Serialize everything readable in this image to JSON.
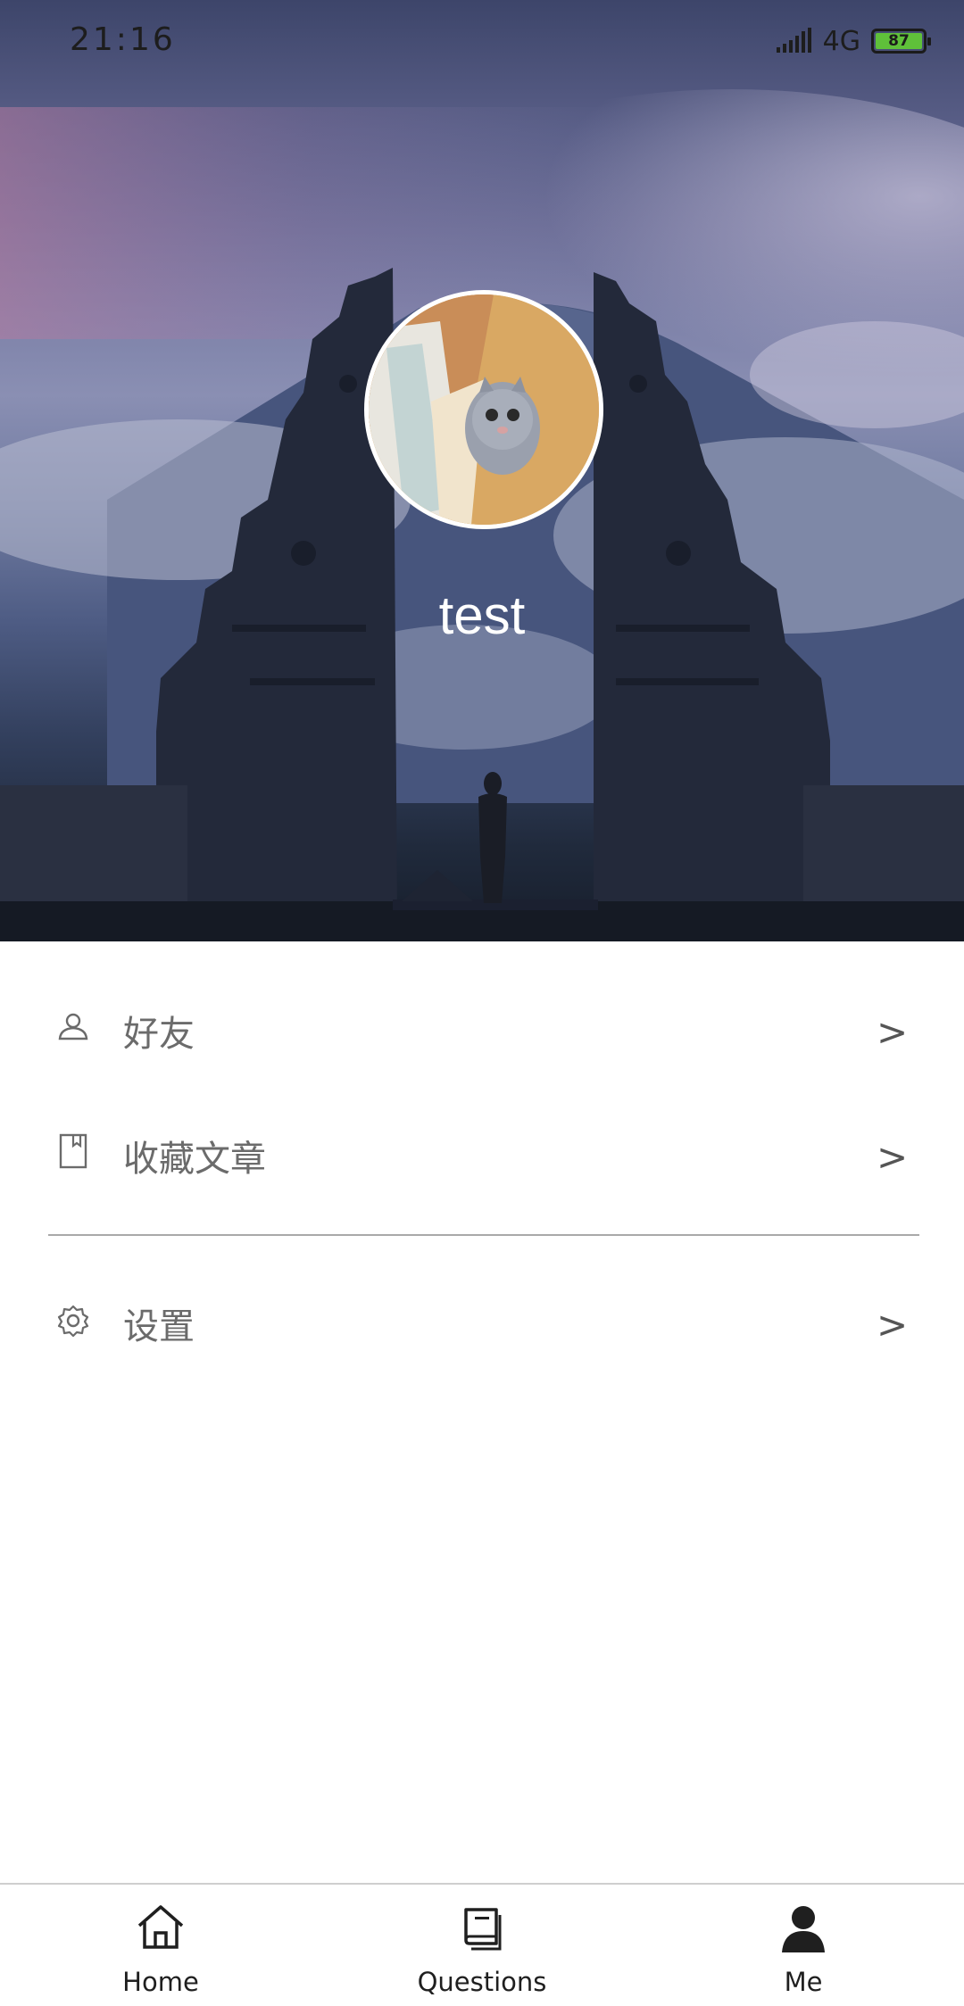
{
  "status_bar": {
    "time": "21:16",
    "network": "4G",
    "battery_level": "87"
  },
  "profile": {
    "username": "test",
    "avatar_icon": "cat-photo-avatar"
  },
  "menu": {
    "items": [
      {
        "label": "好友",
        "icon": "user-icon",
        "arrow": ">"
      },
      {
        "label": "收藏文章",
        "icon": "bookmark-icon",
        "arrow": ">"
      },
      {
        "label": "设置",
        "icon": "gear-icon",
        "arrow": ">"
      }
    ]
  },
  "tabbar": {
    "tabs": [
      {
        "label": "Home",
        "icon": "home-icon"
      },
      {
        "label": "Questions",
        "icon": "book-icon"
      },
      {
        "label": "Me",
        "icon": "person-icon",
        "active": true
      }
    ]
  },
  "colors": {
    "menu_text": "#6b6b6b",
    "divider": "#a9a9a9",
    "battery": "#5fc03a"
  }
}
